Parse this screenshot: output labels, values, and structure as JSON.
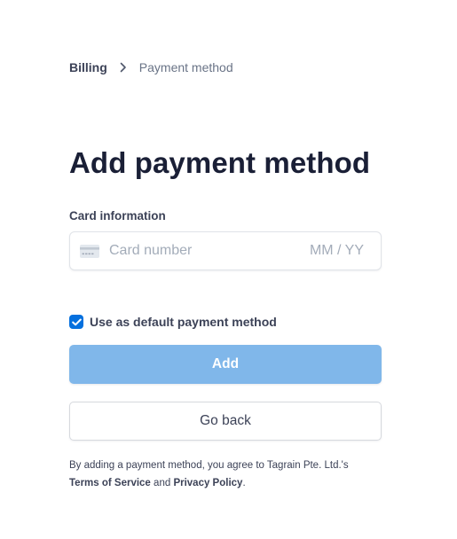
{
  "breadcrumb": {
    "parent": "Billing",
    "current": "Payment method"
  },
  "page": {
    "title": "Add payment method"
  },
  "card": {
    "label": "Card information",
    "number_placeholder": "Card number",
    "expiry_placeholder": "MM / YY",
    "icon": "credit-card-icon"
  },
  "default_option": {
    "label": "Use as default payment method",
    "checked": true
  },
  "actions": {
    "add_label": "Add",
    "back_label": "Go back"
  },
  "legal": {
    "prefix": "By adding a payment method, you agree to Tagrain Pte. Ltd.'s",
    "terms_label": "Terms of Service",
    "conjunction": "and",
    "privacy_label": "Privacy Policy",
    "suffix": "."
  },
  "colors": {
    "accent": "#0570de",
    "add_button_disabled": "#80b7ea",
    "heading": "#1a1f36",
    "muted": "#697386"
  }
}
